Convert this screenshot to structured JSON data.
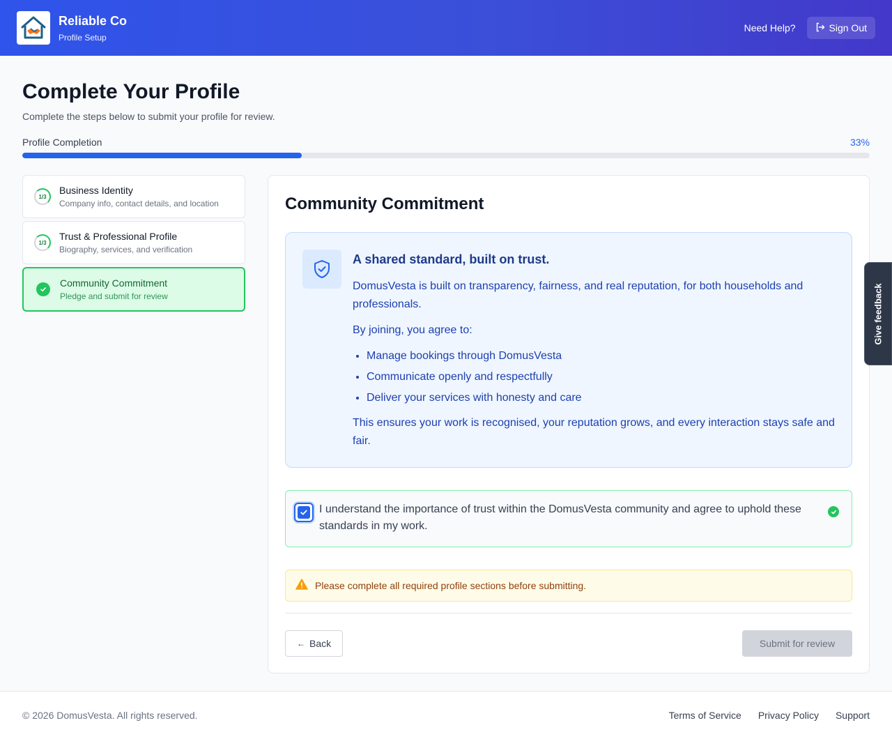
{
  "header": {
    "brand_name": "Reliable Co",
    "brand_sub": "Profile Setup",
    "help_label": "Need Help?",
    "signout_label": "Sign Out"
  },
  "page": {
    "title": "Complete Your Profile",
    "subtitle": "Complete the steps below to submit your profile for review."
  },
  "progress": {
    "label": "Profile Completion",
    "percent_label": "33%",
    "fraction": 0.33
  },
  "steps": [
    {
      "badge": "1/3",
      "title": "Business Identity",
      "description": "Company info, contact details, and location",
      "status": "partial"
    },
    {
      "badge": "1/3",
      "title": "Trust & Professional Profile",
      "description": "Biography, services, and verification",
      "status": "partial"
    },
    {
      "title": "Community Commitment",
      "description": "Pledge and submit for review",
      "status": "complete"
    }
  ],
  "panel": {
    "title": "Community Commitment",
    "info": {
      "heading": "A shared standard, built on trust.",
      "paragraph": "DomusVesta is built on transparency, fairness, and real reputation, for both households and professionals.",
      "join_intro": "By joining, you agree to:",
      "items": [
        "Manage bookings through DomusVesta",
        "Communicate openly and respectfully",
        "Deliver your services with honesty and care"
      ],
      "closing": "This ensures your work is recognised, your reputation grows, and every interaction stays safe and fair."
    },
    "agreement": {
      "text": "I understand the importance of trust within the DomusVesta community and agree to uphold these standards in my work.",
      "checked": true
    },
    "warning": "Please complete all required profile sections before submitting.",
    "back_label": "Back",
    "back_arrow": "←",
    "submit_label": "Submit for review"
  },
  "feedback_label": "Give feedback",
  "footer": {
    "copyright": "© 2026 DomusVesta. All rights reserved.",
    "links": [
      "Terms of Service",
      "Privacy Policy",
      "Support"
    ]
  },
  "colors": {
    "primary": "#2563eb",
    "success": "#22c55e",
    "warning": "#f59e0b"
  },
  "icons": {
    "logo": "house-handshake-logo",
    "signout": "logout-icon",
    "shield": "shield-check-icon",
    "warning": "warning-triangle-icon"
  }
}
